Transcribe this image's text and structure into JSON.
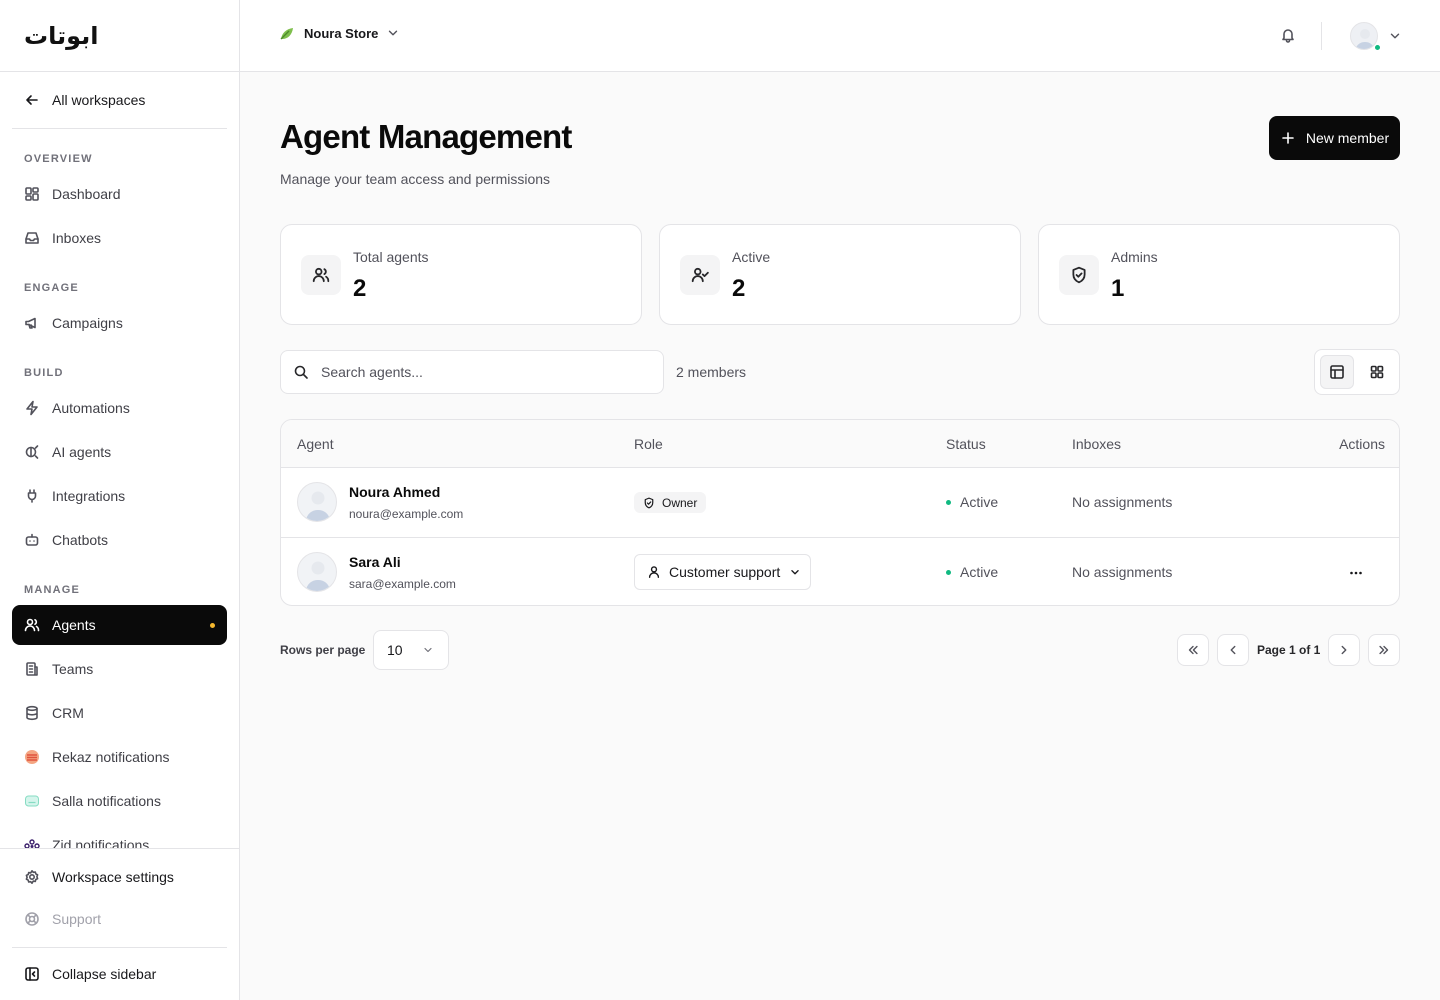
{
  "brand": {
    "logo_text": "ابوتات"
  },
  "sidebar": {
    "back_label": "All workspaces",
    "sections": {
      "overview": "OVERVIEW",
      "engage": "ENGAGE",
      "build": "BUILD",
      "manage": "MANAGE"
    },
    "items": {
      "dashboard": "Dashboard",
      "inboxes": "Inboxes",
      "campaigns": "Campaigns",
      "automations": "Automations",
      "ai_agents": "AI agents",
      "integrations": "Integrations",
      "chatbots": "Chatbots",
      "agents": "Agents",
      "teams": "Teams",
      "crm": "CRM",
      "rekaz": "Rekaz notifications",
      "salla": "Salla notifications",
      "zid": "Zid notifications"
    },
    "bottom": {
      "workspace_settings": "Workspace settings",
      "support": "Support",
      "collapse": "Collapse sidebar"
    },
    "active_item": "agents"
  },
  "header": {
    "store_name": "Noura Store"
  },
  "page": {
    "title": "Agent Management",
    "subtitle": "Manage your team access and permissions",
    "new_member_label": "New member"
  },
  "stats": [
    {
      "label": "Total agents",
      "value": "2"
    },
    {
      "label": "Active",
      "value": "2"
    },
    {
      "label": "Admins",
      "value": "1"
    }
  ],
  "toolbar": {
    "search_placeholder": "Search agents...",
    "members_count": "2 members"
  },
  "table": {
    "columns": {
      "agent": "Agent",
      "role": "Role",
      "status": "Status",
      "inboxes": "Inboxes",
      "actions": "Actions"
    },
    "rows": [
      {
        "name": "Noura Ahmed",
        "email": "noura@example.com",
        "role": "Owner",
        "status": "Active",
        "inboxes": "No assignments"
      },
      {
        "name": "Sara Ali",
        "email": "sara@example.com",
        "role": "Customer support",
        "status": "Active",
        "inboxes": "No assignments"
      }
    ]
  },
  "pagination": {
    "rows_per_page_label": "Rows per page",
    "rows_per_page_value": "10",
    "page_label": "Page 1 of 1"
  },
  "colors": {
    "accent": "#0a0a0a",
    "status_active": "#10b981",
    "active_dot": "#f5b82e"
  }
}
